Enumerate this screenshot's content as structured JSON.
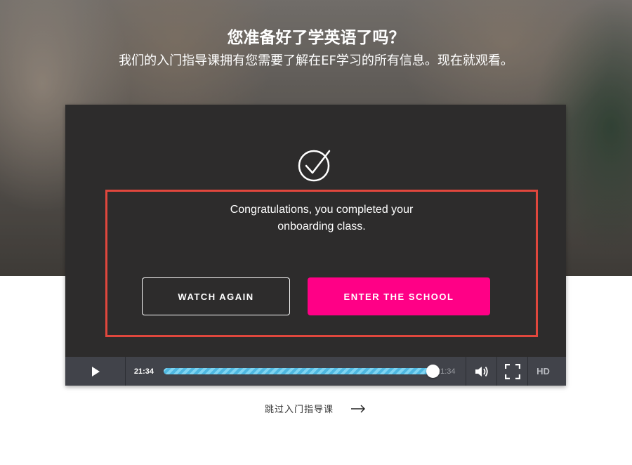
{
  "hero": {
    "headline": "您准备好了学英语了吗？",
    "subline": "我们的入门指导课拥有您需要了解在EF学习的所有信息。现在就观看。"
  },
  "completion": {
    "message_line1": "Congratulations, you completed your",
    "message_line2": "onboarding class.",
    "watch_again_label": "WATCH AGAIN",
    "enter_school_label": "ENTER THE SCHOOL",
    "icon": "checkmark-circle-icon"
  },
  "player_controls": {
    "current_time": "21:34",
    "total_time": "21:34",
    "progress_fraction": 1.0,
    "quality_label": "HD",
    "icons": [
      "play-icon",
      "volume-icon",
      "fullscreen-icon"
    ]
  },
  "footer": {
    "skip_label": "跳过入门指导课",
    "skip_icon": "arrow-right-icon"
  },
  "colors": {
    "accent_pink": "#ff0086",
    "highlight_red": "#e0473d",
    "player_bg": "#2d2c2c",
    "controls_bg": "#41434a",
    "progress_blue": "#7fd4f2"
  }
}
